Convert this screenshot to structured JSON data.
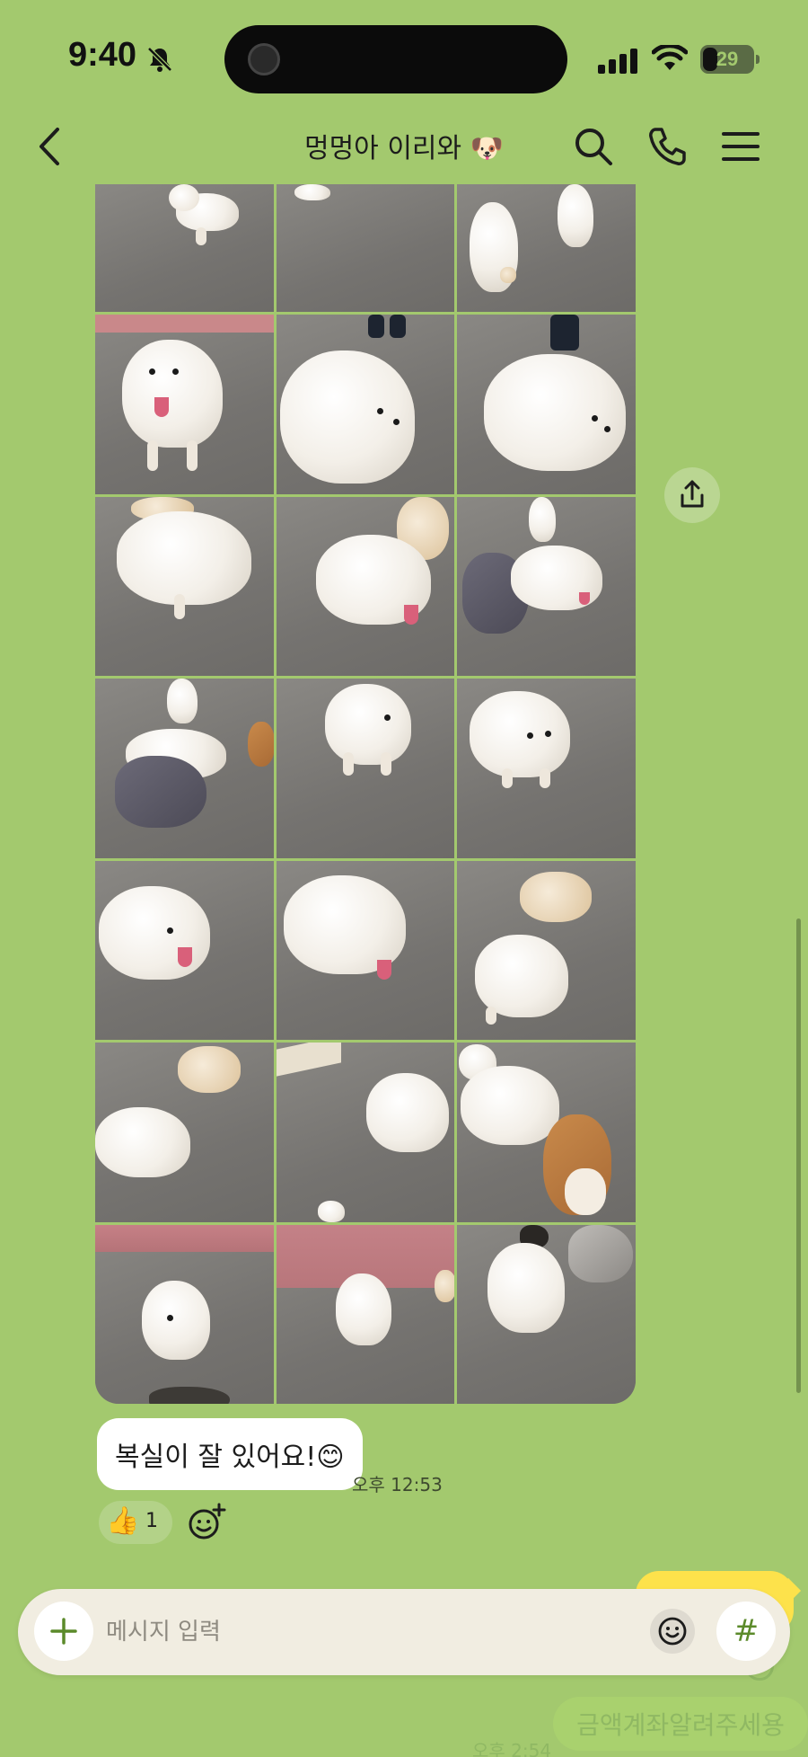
{
  "status_bar": {
    "time": "9:40",
    "battery": "29",
    "battery_level": 0.29
  },
  "header": {
    "title": "멍멍아 이리와 🐶"
  },
  "album": {
    "photo_count": 21
  },
  "message": {
    "text": "복실이 잘 있어요!😊",
    "time": "오후 12:53",
    "reaction_emoji": "👍",
    "reaction_count": "1"
  },
  "background_messages": {
    "faded_text": "금액계좌알려주세용",
    "faded_time": "오후 2:54"
  },
  "input": {
    "placeholder": "메시지 입력",
    "hash_label": "#"
  },
  "colors": {
    "background": "#a3c96e",
    "bubble_mine": "#fde24b",
    "bubble_other": "#ffffff"
  }
}
